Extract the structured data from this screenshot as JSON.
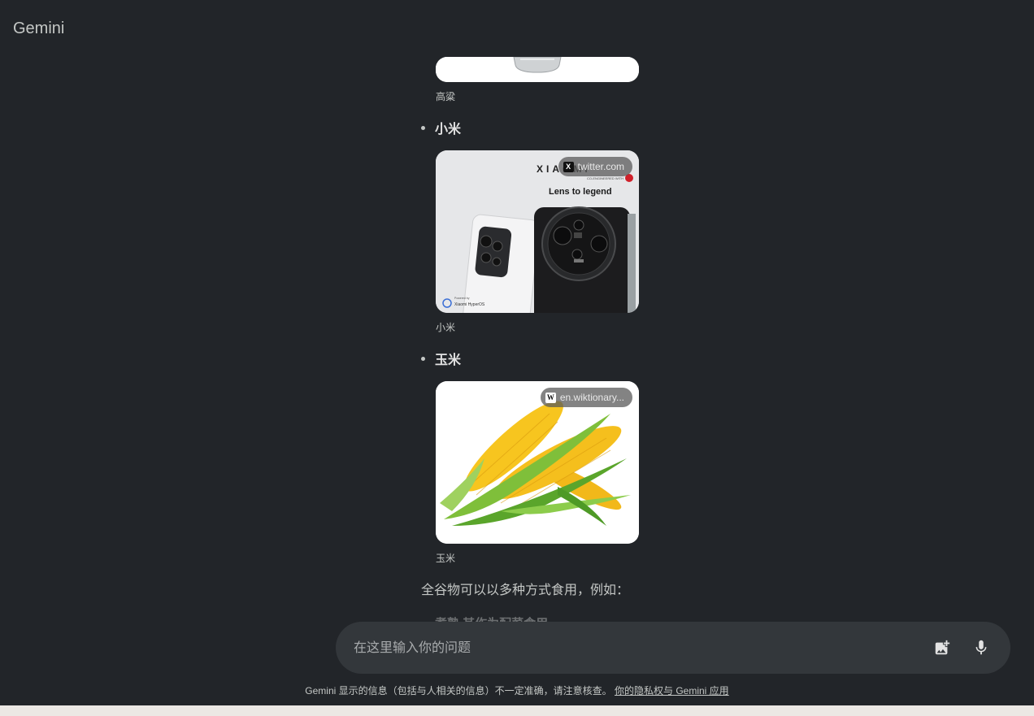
{
  "app": {
    "title": "Gemini"
  },
  "items": [
    {
      "caption": "高粱"
    },
    {
      "label": "小米",
      "caption": "小米",
      "source": "twitter.com",
      "image_text": {
        "brand": "XIAOMI",
        "tagline": "Lens to legend",
        "co": "CO-ENGINEERED WITH",
        "os_small": "Powered by",
        "os": "Xiaomi HyperOS"
      }
    },
    {
      "label": "玉米",
      "caption": "玉米",
      "source": "en.wiktionary..."
    }
  ],
  "paragraph": "全谷物可以以多种方式食用，例如：",
  "faded_item": "煮熟 其作为配菜食用",
  "input": {
    "placeholder": "在这里输入你的问题"
  },
  "footer": {
    "text": "Gemini 显示的信息（包括与人相关的信息）不一定准确，请注意核查。",
    "link": "你的隐私权与 Gemini 应用"
  },
  "icons": {
    "image": "add-image-icon",
    "mic": "microphone-icon"
  }
}
